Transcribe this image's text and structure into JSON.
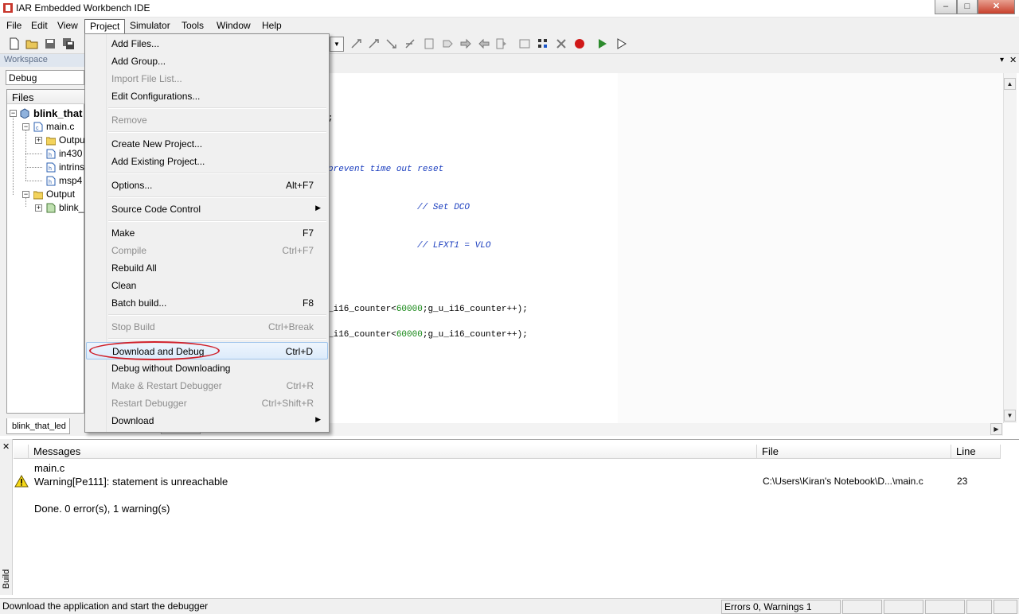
{
  "window": {
    "title": "IAR Embedded Workbench IDE",
    "min": "–",
    "max": "□",
    "close": "✕"
  },
  "menubar": [
    "File",
    "Edit",
    "View",
    "Project",
    "Simulator",
    "Tools",
    "Window",
    "Help"
  ],
  "workspace": {
    "header": "Workspace",
    "config": "Debug",
    "files_header": "Files",
    "tree": [
      {
        "label": "blink_that",
        "bold": true
      },
      {
        "label": "main.c"
      },
      {
        "label": "Outpu"
      },
      {
        "label": "in430"
      },
      {
        "label": "intrins"
      },
      {
        "label": "msp4"
      },
      {
        "label": "Output"
      },
      {
        "label": "blink_"
      }
    ],
    "tab": "blink_that_led"
  },
  "editor": {
    "lines": [
      {
        "text": ";"
      },
      {
        "comment": "prevent time out reset"
      },
      {
        "comment": "// Set DCO"
      },
      {
        "comment": "// LFXT1 = VLO"
      },
      {
        "pre": "_i16_counter<",
        "num": "60000",
        "post": ";g_u_i16_counter++);"
      },
      {
        "pre": "_i16_counter<",
        "num": "60000",
        "post": ";g_u_i16_counter++);"
      }
    ],
    "tab_fragment": "4?0"
  },
  "project_menu": {
    "items": [
      {
        "label": "Add Files...",
        "shortcut": "",
        "disabled": false
      },
      {
        "label": "Add Group...",
        "shortcut": "",
        "disabled": false
      },
      {
        "label": "Import File List...",
        "shortcut": "",
        "disabled": true
      },
      {
        "label": "Edit Configurations...",
        "shortcut": "",
        "disabled": false
      },
      {
        "label": "Remove",
        "shortcut": "",
        "disabled": true
      },
      {
        "label": "Create New Project...",
        "shortcut": "",
        "disabled": false
      },
      {
        "label": "Add Existing Project...",
        "shortcut": "",
        "disabled": false
      },
      {
        "label": "Options...",
        "shortcut": "Alt+F7",
        "disabled": false
      },
      {
        "label": "Source Code Control",
        "shortcut": "",
        "disabled": false
      },
      {
        "label": "Make",
        "shortcut": "F7",
        "disabled": false
      },
      {
        "label": "Compile",
        "shortcut": "Ctrl+F7",
        "disabled": true
      },
      {
        "label": "Rebuild All",
        "shortcut": "",
        "disabled": false
      },
      {
        "label": "Clean",
        "shortcut": "",
        "disabled": false
      },
      {
        "label": "Batch build...",
        "shortcut": "F8",
        "disabled": false
      },
      {
        "label": "Stop Build",
        "shortcut": "Ctrl+Break",
        "disabled": true
      },
      {
        "label": "Download and Debug",
        "shortcut": "Ctrl+D",
        "disabled": false
      },
      {
        "label": "Debug without Downloading",
        "shortcut": "",
        "disabled": false
      },
      {
        "label": "Make & Restart Debugger",
        "shortcut": "Ctrl+R",
        "disabled": true
      },
      {
        "label": "Restart Debugger",
        "shortcut": "Ctrl+Shift+R",
        "disabled": true
      },
      {
        "label": "Download",
        "shortcut": "",
        "disabled": false
      }
    ]
  },
  "build": {
    "side_label": "Build",
    "close": "✕",
    "columns": [
      "Messages",
      "File",
      "Line"
    ],
    "messages": [
      {
        "text": "main.c",
        "file": "",
        "line": ""
      },
      {
        "text": "Warning[Pe111]: statement is unreachable",
        "file": "C:\\Users\\Kiran's Notebook\\D...\\main.c",
        "line": "23"
      },
      {
        "text": "Done. 0 error(s), 1 warning(s)",
        "file": "",
        "line": ""
      }
    ]
  },
  "status": {
    "text": "Download the application and start the debugger",
    "errors": "Errors 0, Warnings 1"
  },
  "colors": {
    "highlight_oval": "#d0202a",
    "comment": "#1c3fbf",
    "number": "#138613"
  }
}
